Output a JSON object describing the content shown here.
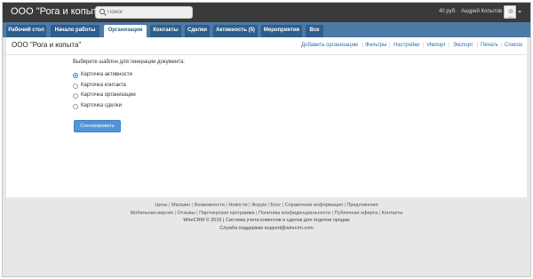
{
  "header": {
    "company": "ООО \"Рога и копыта\"",
    "search_placeholder": "Поиск",
    "balance": "40 руб.",
    "user": "Андрей Копытов"
  },
  "nav": {
    "tabs": [
      {
        "label": "Рабочий стол"
      },
      {
        "label": "Начало работы"
      },
      {
        "label": "Организации",
        "active": true
      },
      {
        "label": "Контакты"
      },
      {
        "label": "Сделки"
      },
      {
        "label": "Активность (5)"
      },
      {
        "label": "Мероприятия"
      },
      {
        "label": "Все"
      }
    ]
  },
  "page": {
    "title": "ООО \"Рога и копыта\"",
    "actions": [
      "Добавить организацию",
      "Фильтры",
      "Настройки",
      "Импорт",
      "Экспорт",
      "Печать",
      "Список"
    ]
  },
  "form": {
    "prompt": "Выберите шаблон для генерации документа:",
    "options": [
      {
        "label": "Карточка активности",
        "checked": true
      },
      {
        "label": "Карточка контакта",
        "checked": false
      },
      {
        "label": "Карточка организации",
        "checked": false
      },
      {
        "label": "Карточка сделки",
        "checked": false
      }
    ],
    "submit_label": "Сгенерировать"
  },
  "footer": {
    "line1": [
      "Цены",
      "Магазин",
      "Возможности",
      "Новости",
      "Форум",
      "Блог",
      "Справочная информация",
      "Предложения"
    ],
    "line2": [
      "Мобильная версия",
      "Отзывы",
      "Партнерская программа",
      "Политика конфиденциальности",
      "Публичная оферта",
      "Контакты"
    ],
    "line3": "WireCRM © 2016 | Система учета клиентов и сделок для отделов продаж",
    "line4": "Служба поддержки support@wirecrm.com"
  },
  "colors": {
    "topbar": "#3a3a3a",
    "navbar": "#4d7aa6",
    "tab": "#2f5e8c",
    "link": "#2a6fb0",
    "button": "#4f94d6"
  }
}
